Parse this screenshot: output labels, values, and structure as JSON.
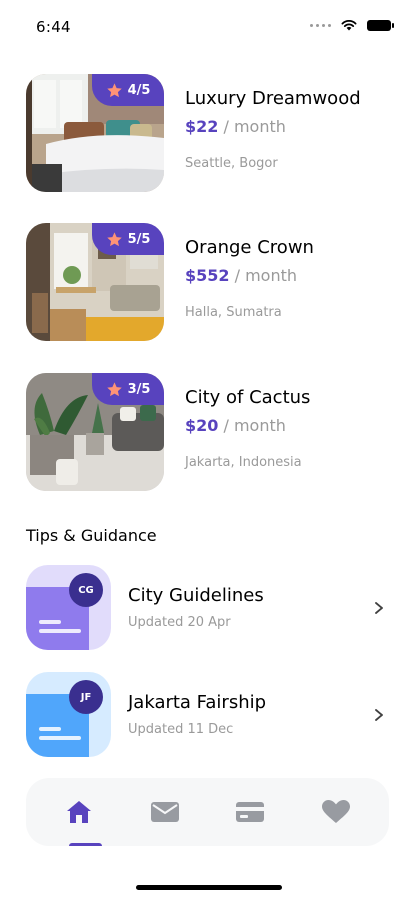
{
  "status_bar": {
    "time": "6:44"
  },
  "spaces": [
    {
      "name": "Luxury Dreamwood",
      "price": "$22",
      "unit": " / month",
      "location": "Seattle, Bogor",
      "rating": "4/5"
    },
    {
      "name": "Orange Crown",
      "price": "$552",
      "unit": " / month",
      "location": "Halla, Sumatra",
      "rating": "5/5"
    },
    {
      "name": "City of Cactus",
      "price": "$20",
      "unit": " / month",
      "location": "Jakarta, Indonesia",
      "rating": "3/5"
    }
  ],
  "tips": {
    "title": "Tips & Guidance",
    "items": [
      {
        "title": "City Guidelines",
        "updated": "Updated 20 Apr",
        "initials": "CG"
      },
      {
        "title": "Jakarta Fairship",
        "updated": "Updated 11 Dec",
        "initials": "JF"
      }
    ]
  },
  "nav": {
    "items": [
      "home-icon",
      "mail-icon",
      "card-icon",
      "heart-icon"
    ],
    "active": "home-icon"
  },
  "colors": {
    "accent": "#5843be",
    "star": "#ff9376",
    "muted": "#9a9a9a",
    "nav_inactive": "#989ba1",
    "nav_background": "#f6f7f8"
  }
}
